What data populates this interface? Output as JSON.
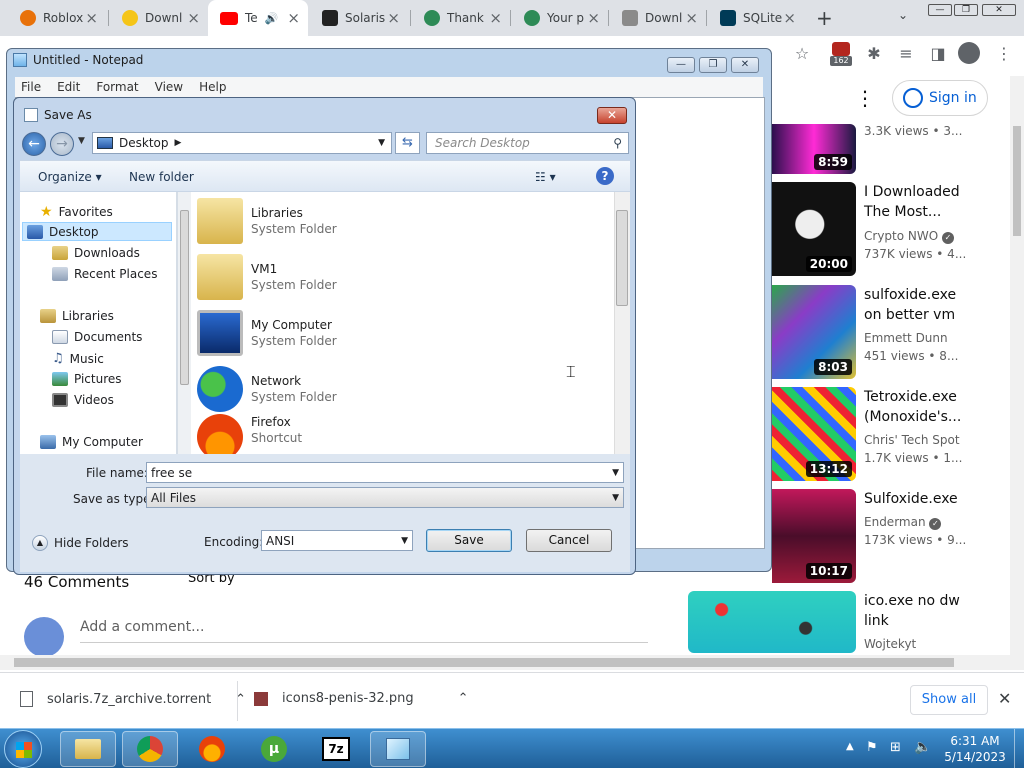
{
  "browser": {
    "tabs": [
      {
        "label": "Roblox",
        "color": "#e8710a"
      },
      {
        "label": "Downl",
        "color": "#f5c518"
      },
      {
        "label": "Te",
        "color": "#ff0000",
        "active": true
      },
      {
        "label": "Solaris",
        "color": "#222222"
      },
      {
        "label": "Thank",
        "color": "#2e8b57"
      },
      {
        "label": "Your p",
        "color": "#2e8b57"
      },
      {
        "label": "Downl",
        "color": "#8a8a8a"
      },
      {
        "label": "SQLite",
        "color": "#003b57"
      }
    ],
    "new_tab": "+",
    "extension_badge": "162",
    "sign_in": "Sign in"
  },
  "youtube": {
    "comments_count": "46 Comments",
    "sort_by": "Sort by",
    "add_comment_placeholder": "Add a comment...",
    "sidebar": [
      {
        "title": "",
        "channel": "",
        "views": "3.3K views • 3...",
        "duration": "8:59"
      },
      {
        "title": "I Downloaded The Most...",
        "channel": "Crypto NWO",
        "verified": true,
        "views": "737K views • 4...",
        "duration": "20:00"
      },
      {
        "title": "sulfoxide.exe on better vm",
        "channel": "Emmett Dunn",
        "views": "451 views • 8...",
        "duration": "8:03"
      },
      {
        "title": "Tetroxide.exe (Monoxide's...",
        "channel": "Chris' Tech Spot",
        "views": "1.7K views • 1...",
        "duration": "13:12"
      },
      {
        "title": "Sulfoxide.exe",
        "channel": "Enderman",
        "verified": true,
        "views": "173K views • 9...",
        "duration": "10:17"
      },
      {
        "title": "ico.exe no dw link",
        "channel": "Wojtekyt",
        "views": "",
        "duration": ""
      }
    ]
  },
  "notepad": {
    "title": "Untitled - Notepad",
    "menu": [
      "File",
      "Edit",
      "Format",
      "View",
      "Help"
    ]
  },
  "save_dialog": {
    "title": "Save As",
    "breadcrumb": "Desktop",
    "search_placeholder": "Search Desktop",
    "organize": "Organize",
    "new_folder": "New folder",
    "nav": {
      "favorites": "Favorites",
      "favorites_items": [
        "Desktop",
        "Downloads",
        "Recent Places"
      ],
      "libraries": "Libraries",
      "libraries_items": [
        "Documents",
        "Music",
        "Pictures",
        "Videos"
      ],
      "computer": "My Computer"
    },
    "files": [
      {
        "name": "Libraries",
        "type": "System Folder"
      },
      {
        "name": "VM1",
        "type": "System Folder"
      },
      {
        "name": "My Computer",
        "type": "System Folder"
      },
      {
        "name": "Network",
        "type": "System Folder"
      },
      {
        "name": "Firefox",
        "type": "Shortcut"
      }
    ],
    "file_name_label": "File name:",
    "file_name_value": "free se",
    "save_type_label": "Save as type:",
    "save_type_value": "All Files",
    "hide_folders": "Hide Folders",
    "encoding_label": "Encoding:",
    "encoding_value": "ANSI",
    "save": "Save",
    "cancel": "Cancel"
  },
  "downloads": {
    "items": [
      {
        "name": "solaris.7z_archive.torrent"
      },
      {
        "name": "icons8-penis-32.png"
      }
    ],
    "show_all": "Show all"
  },
  "taskbar": {
    "time": "6:31 AM",
    "date": "5/14/2023"
  }
}
